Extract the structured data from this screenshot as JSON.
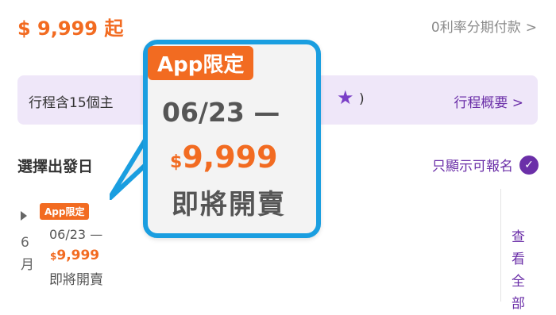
{
  "header": {
    "price": "$ 9,999 起",
    "installment_label": "0利率分期付款",
    "installment_chevron": ">"
  },
  "itinerary": {
    "text": "行程含15個主",
    "close_paren": ")",
    "link_label": "行程概要",
    "link_chevron": ">",
    "star_icon": "star-icon"
  },
  "departure": {
    "title": "選擇出發日",
    "filter_label": "只顯示可報名",
    "filter_icon": "check-circle-icon"
  },
  "calendar": {
    "month_label": "6月",
    "view_all_label": "查看全部",
    "date_card": {
      "badge": "App限定",
      "date_range": "06/23 —",
      "currency": "$",
      "price": "9,999",
      "status": "即將開賣"
    }
  },
  "callout": {
    "badge": "App限定",
    "date_range": "06/23 —",
    "currency": "$",
    "price": "9,999",
    "status": "即將開賣"
  },
  "colors": {
    "accent_orange": "#f26b21",
    "accent_purple": "#6b2fa8",
    "callout_border": "#1a9ee0",
    "itinerary_bg": "#efe7f9"
  }
}
